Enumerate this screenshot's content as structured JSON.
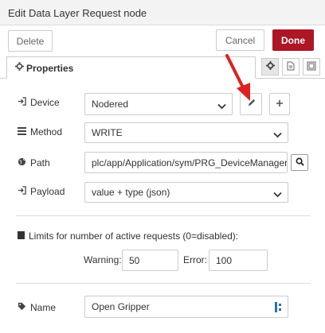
{
  "dialog": {
    "title": "Edit Data Layer Request node"
  },
  "buttons": {
    "delete": "Delete",
    "cancel": "Cancel",
    "done": "Done"
  },
  "tabs": {
    "properties": "Properties"
  },
  "form": {
    "device": {
      "label": "Device",
      "value": "Nodered"
    },
    "method": {
      "label": "Method",
      "value": "WRITE"
    },
    "path": {
      "label": "Path",
      "value": "plc/app/Application/sym/PRG_DeviceManager/Se"
    },
    "payload": {
      "label": "Payload",
      "value": "value + type (json)"
    },
    "limits": {
      "label": "Limits for number of active requests (0=disabled):",
      "warning_label": "Warning:",
      "warning_value": "50",
      "error_label": "Error:",
      "error_value": "100"
    },
    "name": {
      "label": "Name",
      "value": "Open Gripper"
    }
  },
  "colors": {
    "primary": "#ad1625",
    "annotation_arrow": "#e02020"
  },
  "icons": [
    "cog-icon",
    "file-icon",
    "layout-icon",
    "sign-in-icon",
    "pencil-icon",
    "plus-icon",
    "list-icon",
    "globe-icon",
    "search-icon",
    "tag-icon",
    "square-icon",
    "chevron-down-icon",
    "toggle-icon"
  ]
}
